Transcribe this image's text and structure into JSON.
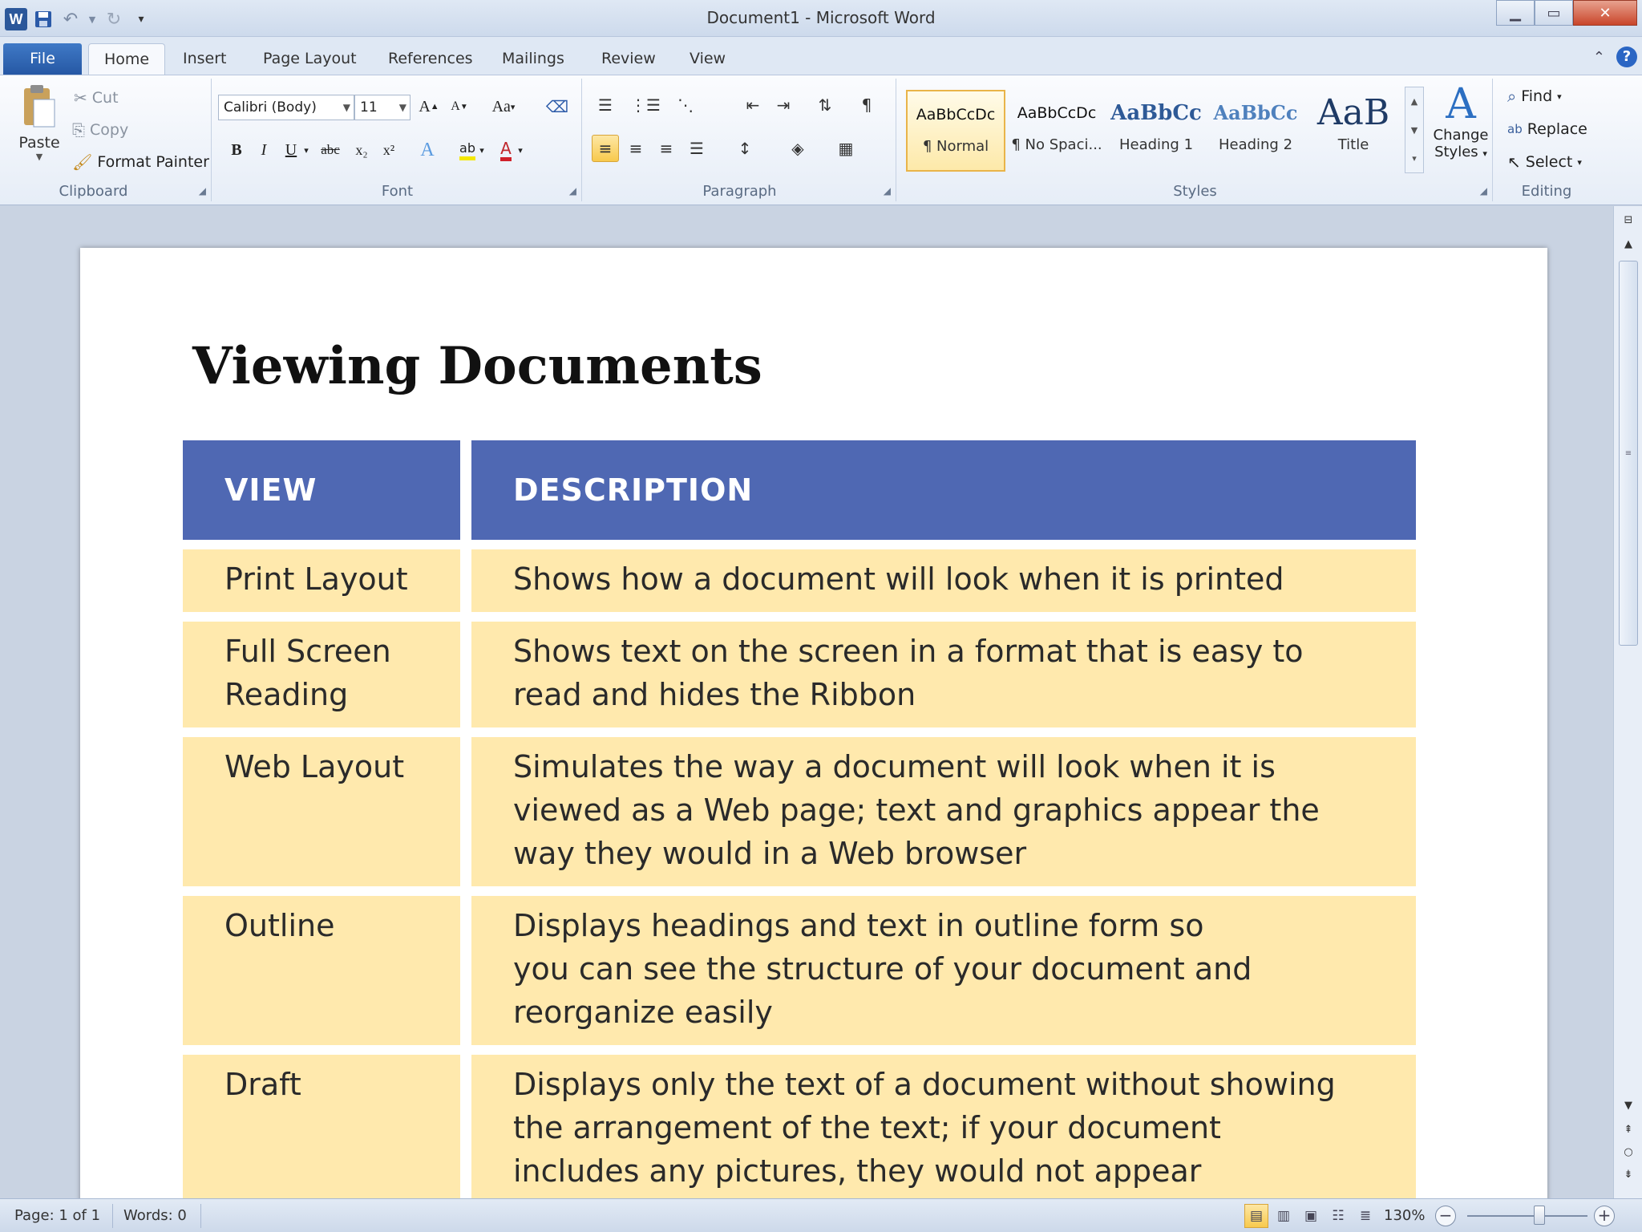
{
  "window": {
    "title": "Document1 - Microsoft Word",
    "app_icon": "W"
  },
  "tabs": [
    {
      "label": "File"
    },
    {
      "label": "Home"
    },
    {
      "label": "Insert"
    },
    {
      "label": "Page Layout"
    },
    {
      "label": "References"
    },
    {
      "label": "Mailings"
    },
    {
      "label": "Review"
    },
    {
      "label": "View"
    }
  ],
  "clipboard": {
    "paste": "Paste",
    "cut": "Cut",
    "copy": "Copy",
    "format_painter": "Format Painter",
    "group": "Clipboard"
  },
  "font": {
    "name": "Calibri (Body)",
    "size": "11",
    "group": "Font",
    "change_case": "Aa",
    "grow": "A",
    "shrink": "A",
    "bold": "B",
    "italic": "I",
    "underline": "U",
    "strike": "abc",
    "subscript": "x₂",
    "superscript": "x²",
    "highlight": "ab",
    "color": "A"
  },
  "paragraph": {
    "group": "Paragraph",
    "pilcrow": "¶"
  },
  "styles": {
    "group": "Styles",
    "tiles": [
      {
        "sample": "AaBbCcDc",
        "name": "¶ Normal"
      },
      {
        "sample": "AaBbCcDc",
        "name": "¶ No Spaci..."
      },
      {
        "sample": "AaBbCc",
        "name": "Heading 1"
      },
      {
        "sample": "AaBbCc",
        "name": "Heading 2"
      },
      {
        "sample": "AaB",
        "name": "Title"
      }
    ],
    "change_styles_line1": "Change",
    "change_styles_line2": "Styles"
  },
  "editing": {
    "group": "Editing",
    "find": "Find",
    "replace": "Replace",
    "select": "Select"
  },
  "document": {
    "heading": "Viewing Documents",
    "table": {
      "headers": [
        "VIEW",
        "DESCRIPTION"
      ],
      "rows": [
        {
          "view": "Print Layout",
          "desc": "Shows how a document will look when it is printed"
        },
        {
          "view_line1": "Full Screen",
          "view_line2": "Reading",
          "desc_line1": "Shows text on the screen in a format that is easy to",
          "desc_line2": "read and hides the Ribbon"
        },
        {
          "view": "Web Layout",
          "desc_line1": "Simulates the way a document will look when it is",
          "desc_line2": "viewed as a Web page; text and graphics appear the",
          "desc_line3": "way they would in a Web browser"
        },
        {
          "view": "Outline",
          "desc_line1": "Displays headings and text in outline form so",
          "desc_line2": "you can see the structure of your document and",
          "desc_line3": "reorganize easily"
        },
        {
          "view": "Draft",
          "desc_line1": "Displays only the text of a document without showing",
          "desc_line2": "the arrangement of the text; if your document",
          "desc_line3": "includes any pictures, they would not appear"
        }
      ]
    }
  },
  "status": {
    "page": "Page: 1 of 1",
    "words": "Words: 0",
    "zoom": "130%",
    "zoom_fraction": 0.6
  },
  "colors": {
    "table_header": "#4f68b3",
    "table_cell": "#ffe9ad",
    "file_tab": "#2b579a"
  }
}
